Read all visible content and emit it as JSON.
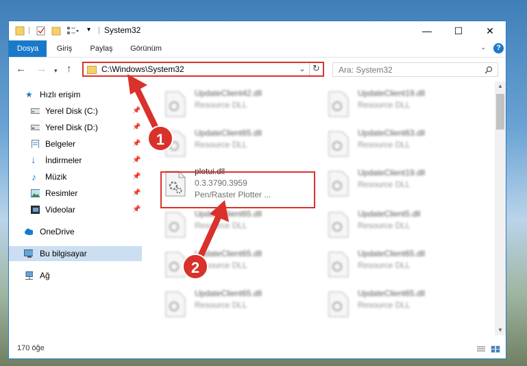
{
  "window": {
    "title": "System32",
    "controls": {
      "minimize": "—",
      "maximize": "☐",
      "close": "✕"
    }
  },
  "ribbon": {
    "tabs": [
      {
        "label": "Dosya",
        "active": true
      },
      {
        "label": "Giriş"
      },
      {
        "label": "Paylaş"
      },
      {
        "label": "Görünüm"
      }
    ]
  },
  "address": {
    "path": "C:\\Windows\\System32",
    "search_placeholder": "Ara: System32"
  },
  "nav": {
    "quick_access": "Hızlı erişim",
    "items": [
      {
        "label": "Yerel Disk (C:)",
        "icon": "drive-icon",
        "pinned": true
      },
      {
        "label": "Yerel Disk (D:)",
        "icon": "drive-icon",
        "pinned": true
      },
      {
        "label": "Belgeler",
        "icon": "documents-icon",
        "pinned": true
      },
      {
        "label": "İndirmeler",
        "icon": "downloads-icon",
        "pinned": true
      },
      {
        "label": "Müzik",
        "icon": "music-icon",
        "pinned": true
      },
      {
        "label": "Resimler",
        "icon": "pictures-icon",
        "pinned": true
      },
      {
        "label": "Videolar",
        "icon": "videos-icon",
        "pinned": true
      }
    ],
    "onedrive": "OneDrive",
    "this_pc": "Bu bilgisayar",
    "network": "Ağ"
  },
  "files": {
    "left": [
      {
        "name": "UpdateClient42.dll",
        "desc": "Resource DLL"
      },
      {
        "name": "UpdateClient65.dll",
        "desc": "Resource DLL"
      },
      {
        "name": "plotui.dll",
        "version": "0.3.3790.3959",
        "desc": "Pen/Raster Plotter ...",
        "highlighted": true
      },
      {
        "name": "UpdateClient65.dll",
        "desc": "Resource DLL"
      },
      {
        "name": "UpdateClient65.dll",
        "desc": "Resource DLL"
      },
      {
        "name": "UpdateClient65.dll",
        "desc": "Resource DLL"
      }
    ],
    "right": [
      {
        "name": "UpdateClient19.dll",
        "desc": "Resource DLL"
      },
      {
        "name": "UpdateClient63.dll",
        "desc": "Resource DLL"
      },
      {
        "name": "UpdateClient19.dll",
        "desc": "Resource DLL"
      },
      {
        "name": "UpdateClient5.dll",
        "desc": "Resource DLL"
      },
      {
        "name": "UpdateClient65.dll",
        "desc": "Resource DLL"
      },
      {
        "name": "UpdateClient65.dll",
        "desc": "Resource DLL"
      }
    ]
  },
  "status": {
    "count": "170 öğe"
  },
  "annotations": {
    "step1": "1",
    "step2": "2"
  },
  "colors": {
    "accent": "#1979ca",
    "annotation": "#d9312b"
  }
}
